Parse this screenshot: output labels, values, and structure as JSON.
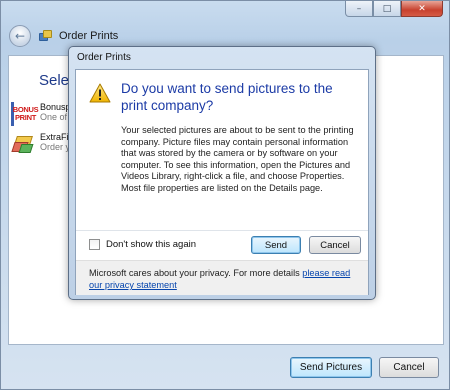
{
  "window": {
    "title": "Order Prints",
    "controls": {
      "minimize": "–",
      "maximize": "□",
      "close": "✕"
    }
  },
  "wizard": {
    "heading": "Select",
    "providers": [
      {
        "name": "Bonusp",
        "subtitle": "One of",
        "logo_text_1": "BONUS",
        "logo_text_2": "PRINT",
        "icon": "bonus-print-logo"
      },
      {
        "name": "ExtraFil",
        "subtitle": "Order y",
        "icon": "extrafilm-logo"
      }
    ],
    "buttons": {
      "send_pictures": "Send Pictures",
      "cancel": "Cancel"
    }
  },
  "dialog": {
    "title": "Order Prints",
    "icon": "warning-icon",
    "main_instruction": "Do you want to send pictures to the print company?",
    "body": "Your selected pictures are about to be sent to the printing company. Picture files may contain personal information that was stored by the camera or by software on your computer. To see this information, open the Pictures and Videos Library, right-click a file, and choose Properties. Most file properties are listed on the Details page.",
    "checkbox_label": "Don't show this again",
    "checkbox_checked": false,
    "buttons": {
      "send": "Send",
      "cancel": "Cancel"
    },
    "privacy_text": "Microsoft cares about your privacy. For more details ",
    "privacy_link": "please read our privacy statement"
  },
  "colors": {
    "instruction_blue": "#1c3ba6",
    "link_blue": "#0645ad",
    "close_red": "#c8412e"
  }
}
